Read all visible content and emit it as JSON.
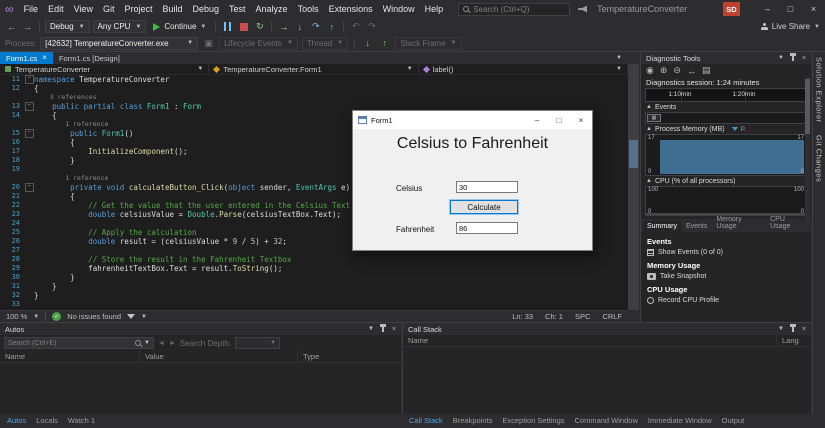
{
  "titlebar": {
    "menus": [
      "File",
      "Edit",
      "View",
      "Git",
      "Project",
      "Build",
      "Debug",
      "Test",
      "Analyze",
      "Tools",
      "Extensions",
      "Window",
      "Help"
    ],
    "search_placeholder": "Search (Ctrl+Q)",
    "window_title": "TemperatureConverter",
    "avatar": "SD",
    "window_buttons": [
      "–",
      "□",
      "×"
    ]
  },
  "toolbar": {
    "debug_config": "Debug",
    "platform": "Any CPU",
    "continue_label": "Continue",
    "live_share": "Live Share"
  },
  "debug_location": {
    "process_label": "Process:",
    "process_value": "[42632] TemperatureConverter.exe",
    "lifecycle": "Lifecycle Events",
    "thread": "Thread",
    "stack_frame": "Stack Frame"
  },
  "doc_tabs": [
    {
      "label": "Form1.cs",
      "active": true
    },
    {
      "label": "Form1.cs [Design]",
      "active": false
    }
  ],
  "breadcrumb": {
    "project": "TemperatureConverter",
    "type": "TemperatureConverter.Form1",
    "member": "label()"
  },
  "editor": {
    "lines": [
      {
        "n": "11",
        "fold": true,
        "tk": [
          [
            "namespace ",
            "kw"
          ],
          [
            "TemperatureConverter",
            "pl"
          ]
        ]
      },
      {
        "n": "12",
        "tk": [
          [
            "{",
            "pl"
          ]
        ]
      },
      {
        "lens": "3 references",
        "pad": "    "
      },
      {
        "n": "13",
        "fold": true,
        "tk": [
          [
            "    ",
            "pl"
          ],
          [
            "public partial class ",
            "kw"
          ],
          [
            "Form1",
            "ty"
          ],
          [
            " : ",
            "pl"
          ],
          [
            "Form",
            "ty"
          ]
        ]
      },
      {
        "n": "14",
        "tk": [
          [
            "    {",
            "pl"
          ]
        ]
      },
      {
        "lens": "1 reference",
        "pad": "        "
      },
      {
        "n": "15",
        "fold": true,
        "tk": [
          [
            "        ",
            "pl"
          ],
          [
            "public ",
            "kw"
          ],
          [
            "Form1",
            "ty"
          ],
          [
            "()",
            "pl"
          ]
        ]
      },
      {
        "n": "16",
        "tk": [
          [
            "        {",
            "pl"
          ]
        ]
      },
      {
        "n": "17",
        "tk": [
          [
            "            ",
            "pl"
          ],
          [
            "InitializeComponent",
            "me"
          ],
          [
            "();",
            "pl"
          ]
        ]
      },
      {
        "n": "18",
        "tk": [
          [
            "        }",
            "pl"
          ]
        ]
      },
      {
        "n": "19",
        "tk": []
      },
      {
        "lens": "1 reference",
        "pad": "        "
      },
      {
        "n": "20",
        "fold": true,
        "tk": [
          [
            "        ",
            "pl"
          ],
          [
            "private void ",
            "kw"
          ],
          [
            "calculateButton_Click",
            "me"
          ],
          [
            "(",
            "pl"
          ],
          [
            "object",
            "kw"
          ],
          [
            " sender, ",
            "pl"
          ],
          [
            "EventArgs",
            "ty"
          ],
          [
            " e)",
            "pl"
          ]
        ]
      },
      {
        "n": "21",
        "tk": [
          [
            "        {",
            "pl"
          ]
        ]
      },
      {
        "n": "22",
        "tk": [
          [
            "            // Get the value that the user entered in the Celsius Text Box",
            "co"
          ]
        ]
      },
      {
        "n": "23",
        "tk": [
          [
            "            ",
            "pl"
          ],
          [
            "double",
            "kw"
          ],
          [
            " celsiusValue = ",
            "pl"
          ],
          [
            "Double",
            "ty"
          ],
          [
            ".",
            "pl"
          ],
          [
            "Parse",
            "me"
          ],
          [
            "(celsiusTextBox.Text);",
            "pl"
          ]
        ]
      },
      {
        "n": "24",
        "tk": []
      },
      {
        "n": "25",
        "tk": [
          [
            "            // Apply the calculation",
            "co"
          ]
        ]
      },
      {
        "n": "26",
        "tk": [
          [
            "            ",
            "pl"
          ],
          [
            "double",
            "kw"
          ],
          [
            " result = (celsiusValue * ",
            "pl"
          ],
          [
            "9",
            "nu"
          ],
          [
            " / ",
            "pl"
          ],
          [
            "5",
            "nu"
          ],
          [
            ") + ",
            "pl"
          ],
          [
            "32",
            "nu"
          ],
          [
            ";",
            "pl"
          ]
        ]
      },
      {
        "n": "27",
        "tk": []
      },
      {
        "n": "28",
        "tk": [
          [
            "            // Store the result in the Fahrenheit Textbox",
            "co"
          ]
        ]
      },
      {
        "n": "29",
        "tk": [
          [
            "            fahrenheitTextBox.Text = result.",
            "pl"
          ],
          [
            "ToString",
            "me"
          ],
          [
            "();",
            "pl"
          ]
        ]
      },
      {
        "n": "30",
        "tk": [
          [
            "        }",
            "pl"
          ]
        ]
      },
      {
        "n": "31",
        "tk": [
          [
            "    }",
            "pl"
          ]
        ]
      },
      {
        "n": "32",
        "tk": [
          [
            "}",
            "pl"
          ]
        ]
      },
      {
        "n": "33",
        "tk": []
      }
    ],
    "status": {
      "zoom": "100 %",
      "issues": "No issues found",
      "ln": "Ln: 33",
      "ch": "Ch: 1",
      "spc": "SPC",
      "eol": "CRLF"
    }
  },
  "app_window": {
    "title": "Form1",
    "heading": "Celsius to Fahrenheit",
    "celsius_label": "Celsius",
    "celsius_value": "30",
    "calculate_label": "Calculate",
    "fahrenheit_label": "Fahrenheit",
    "fahrenheit_value": "86",
    "window_buttons": [
      "–",
      "□",
      "×"
    ]
  },
  "diagnostics": {
    "title": "Diagnostic Tools",
    "session": "Diagnostics session: 1:24 minutes",
    "ticks": [
      "1:10min",
      "1:20min"
    ],
    "events_header": "Events",
    "memory_header": "Process Memory (MB)",
    "memory_legend": "P.",
    "memory_scale_top": "17",
    "memory_scale_bottom": "0",
    "cpu_header": "CPU (% of all processors)",
    "cpu_scale_top": "100",
    "cpu_scale_bottom": "0",
    "tabs": [
      {
        "label": "Summary",
        "active": true
      },
      {
        "label": "Events",
        "active": false
      },
      {
        "label": "Memory Usage",
        "active": false
      },
      {
        "label": "CPU Usage",
        "active": false
      }
    ],
    "summary": {
      "events_title": "Events",
      "show_events": "Show Events (0 of 0)",
      "memory_title": "Memory Usage",
      "take_snapshot": "Take Snapshot",
      "cpu_title": "CPU Usage",
      "record_profile": "Record CPU Profile"
    }
  },
  "autos": {
    "title": "Autos",
    "search_placeholder": "Search (Ctrl+E)",
    "depth_label": "Search Depth:",
    "columns": [
      "Name",
      "Value",
      "Type"
    ]
  },
  "callstack": {
    "title": "Call Stack",
    "name_col": "Name",
    "lang_col": "Lang"
  },
  "bottom_tabs_left": [
    {
      "label": "Autos",
      "active": true
    },
    {
      "label": "Locals",
      "active": false
    },
    {
      "label": "Watch 1",
      "active": false
    }
  ],
  "bottom_tabs_right": [
    {
      "label": "Call Stack",
      "active": true
    },
    {
      "label": "Breakpoints",
      "active": false
    },
    {
      "label": "Exception Settings",
      "active": false
    },
    {
      "label": "Command Window",
      "active": false
    },
    {
      "label": "Immediate Window",
      "active": false
    },
    {
      "label": "Output",
      "active": false
    }
  ],
  "right_rail": [
    "Solution Explorer",
    "Git Changes"
  ]
}
